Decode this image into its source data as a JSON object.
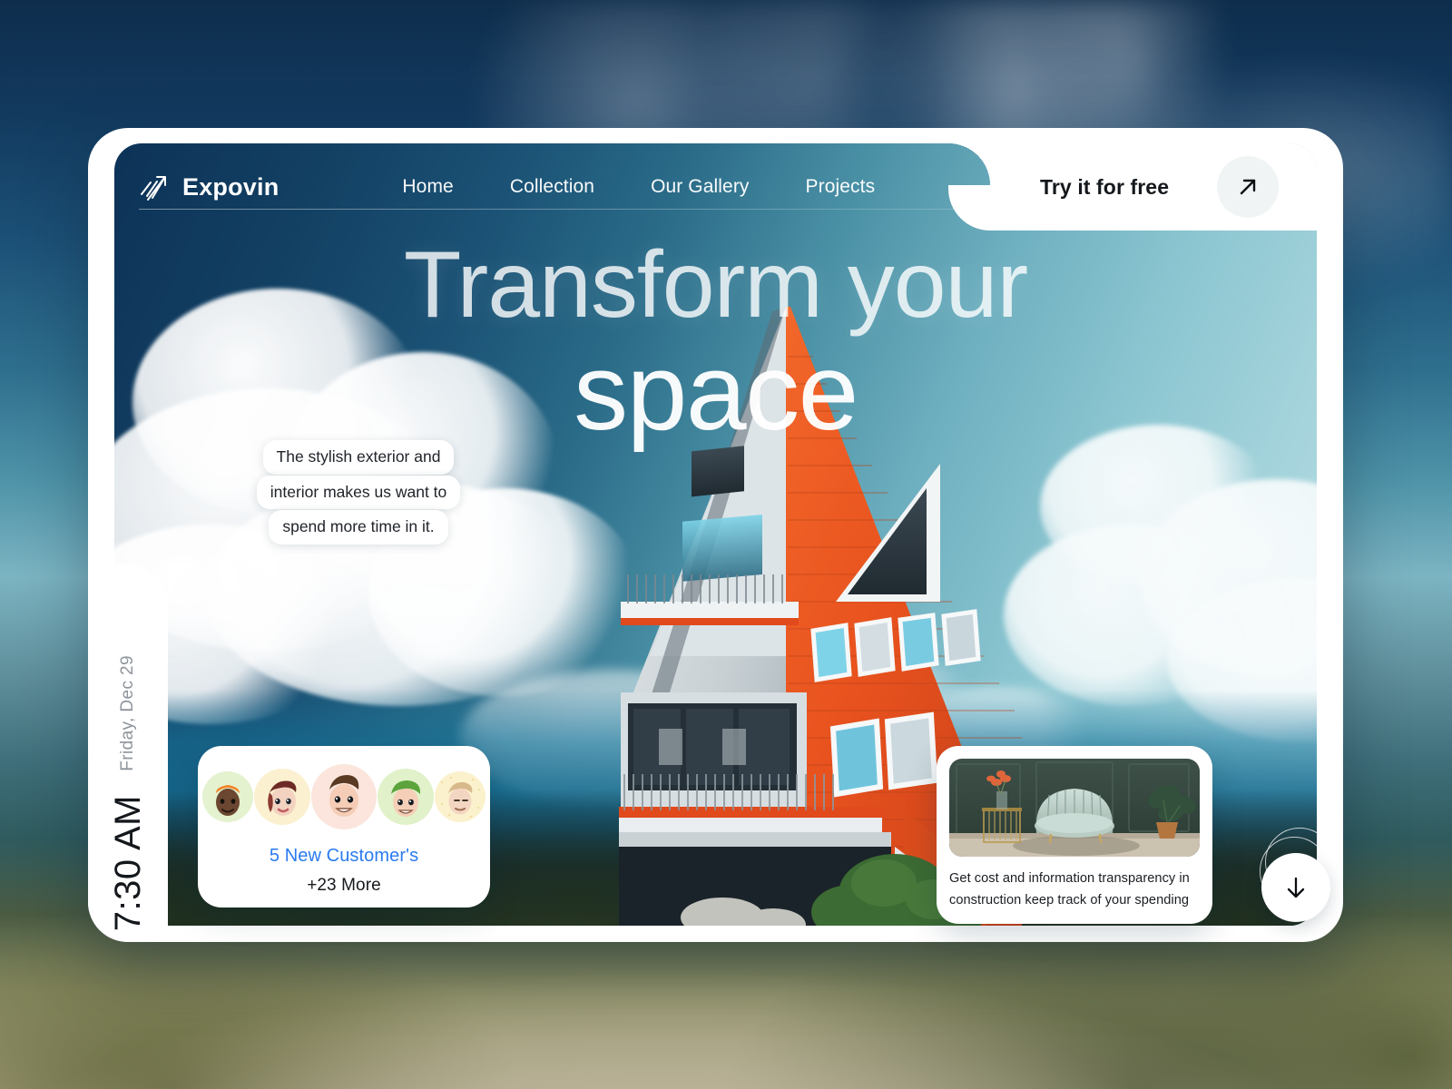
{
  "brand": {
    "name": "Expovin",
    "logo_icon": "rising-arrow-icon"
  },
  "nav": {
    "links": [
      {
        "label": "Home"
      },
      {
        "label": "Collection"
      },
      {
        "label": "Our Gallery"
      },
      {
        "label": "Projects"
      }
    ]
  },
  "cta": {
    "label": "Try it for free",
    "arrow_icon": "arrow-up-right-icon"
  },
  "hero": {
    "headline_line1": "Transform your",
    "headline_line2": "space"
  },
  "quote": {
    "line1": "The stylish exterior and",
    "line2": "interior makes us want to",
    "line3": "spend more time in it."
  },
  "sidebar": {
    "date": "Friday, Dec 29",
    "time": "7:30 AM"
  },
  "customers": {
    "title": "5 New Customer's",
    "more": "+23 More",
    "avatars": [
      {
        "name": "avatar-1",
        "bg": "#e4f2cf",
        "skin": "#6b4630",
        "hair": "#f2852a",
        "hair_style": "cap"
      },
      {
        "name": "avatar-2",
        "bg": "#fbf0cf",
        "skin": "#f3d3c0",
        "hair": "#7a2f2a",
        "hair_style": "ponytail"
      },
      {
        "name": "avatar-3",
        "bg": "#fbe5dc",
        "skin": "#f5cdb6",
        "hair": "#5b3a24",
        "hair_style": "quiff"
      },
      {
        "name": "avatar-4",
        "bg": "#e1f1c9",
        "skin": "#f5cfb8",
        "hair": "#5ca33c",
        "hair_style": "cap"
      },
      {
        "name": "avatar-5",
        "bg": "#fbf1cc",
        "skin": "#f3d6c2",
        "hair": "#d8b98c",
        "hair_style": "short"
      }
    ]
  },
  "info_card": {
    "text": "Get cost and information transparency in construction keep track of your spending",
    "image_alt": "interior-armchair-photo"
  },
  "scroll": {
    "icon": "arrow-down-icon"
  },
  "colors": {
    "accent_orange": "#E8521E",
    "link_blue": "#2B7BF0",
    "sky_dark": "#0D3257",
    "sky_light": "#BFE0E6",
    "card_white": "#FFFFFF",
    "text_dark": "#14181C",
    "text_muted": "#8D949B"
  }
}
